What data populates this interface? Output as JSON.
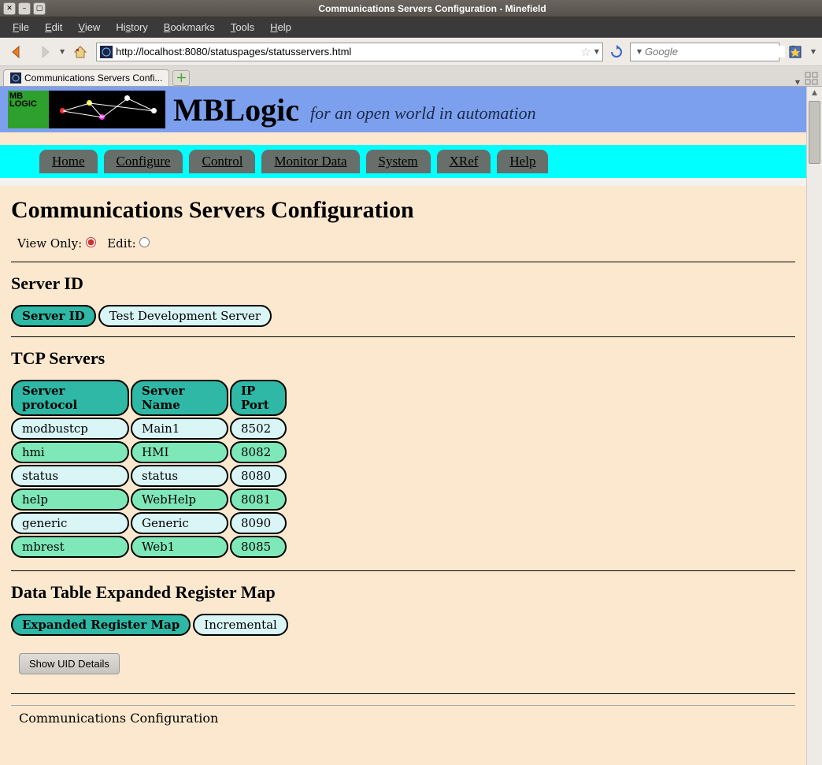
{
  "window": {
    "title": "Communications Servers Configuration - Minefield"
  },
  "menubar": {
    "items": [
      "File",
      "Edit",
      "View",
      "History",
      "Bookmarks",
      "Tools",
      "Help"
    ]
  },
  "toolbar": {
    "url": "http://localhost:8080/statuspages/statusservers.html",
    "search_placeholder": "Google"
  },
  "tab": {
    "title": "Communications Servers Confi..."
  },
  "brand": {
    "name": "MBLogic",
    "tagline": "for an open world in automation",
    "logo_small": "MB LOGIC"
  },
  "nav": {
    "items": [
      "Home",
      "Configure",
      "Control",
      "Monitor Data",
      "System",
      "XRef",
      "Help"
    ]
  },
  "page": {
    "title": "Communications Servers Configuration",
    "view_only_label": "View Only:",
    "edit_label": "Edit:",
    "server_id_heading": "Server ID",
    "server_id_label": "Server ID",
    "server_id_value": "Test Development Server",
    "tcp_heading": "TCP Servers",
    "tcp_headers": [
      "Server protocol",
      "Server Name",
      "IP Port"
    ],
    "tcp_rows": [
      {
        "proto": "modbustcp",
        "name": "Main1",
        "port": "8502"
      },
      {
        "proto": "hmi",
        "name": "HMI",
        "port": "8082"
      },
      {
        "proto": "status",
        "name": "status",
        "port": "8080"
      },
      {
        "proto": "help",
        "name": "WebHelp",
        "port": "8081"
      },
      {
        "proto": "generic",
        "name": "Generic",
        "port": "8090"
      },
      {
        "proto": "mbrest",
        "name": "Web1",
        "port": "8085"
      }
    ],
    "regmap_heading": "Data Table Expanded Register Map",
    "regmap_label": "Expanded Register Map",
    "regmap_value": "Incremental",
    "show_uid_label": "Show UID Details",
    "footer": "Communications Configuration"
  }
}
